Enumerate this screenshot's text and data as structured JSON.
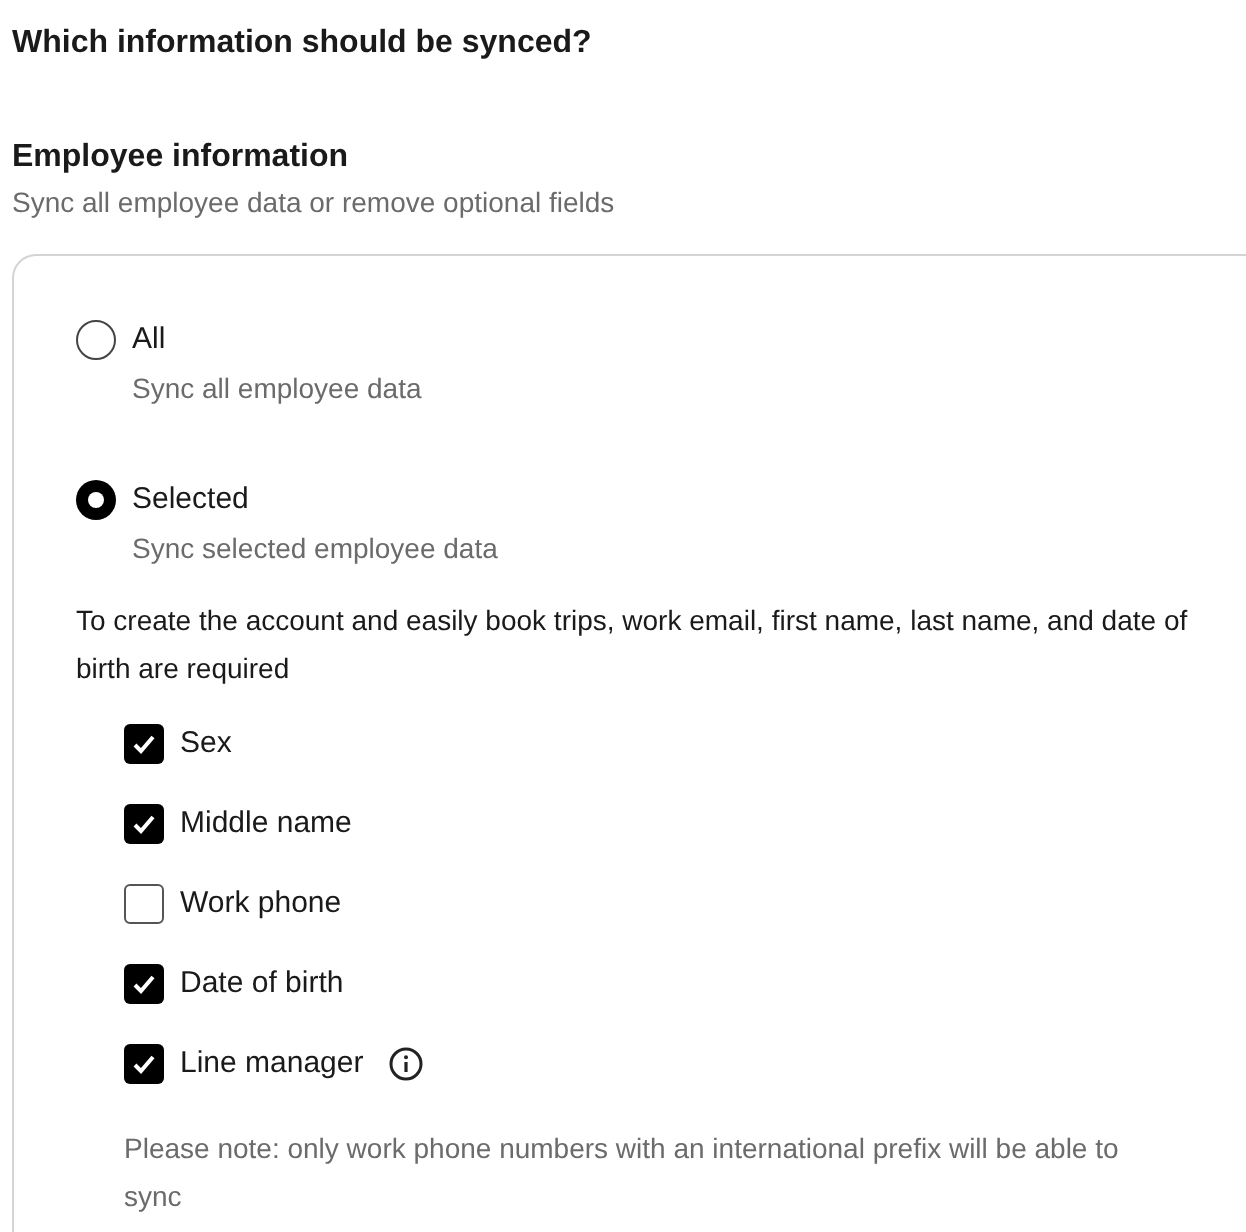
{
  "title": "Which information should be synced?",
  "section": {
    "heading": "Employee information",
    "description": "Sync all employee data or remove optional fields"
  },
  "options": [
    {
      "label": "All",
      "description": "Sync all employee data",
      "selected": false
    },
    {
      "label": "Selected",
      "description": "Sync selected employee data",
      "selected": true
    }
  ],
  "requirement": "To create the account and easily book trips, work email, first name, last name, and date of birth are required",
  "fields": [
    {
      "label": "Sex",
      "checked": true,
      "info": false
    },
    {
      "label": "Middle name",
      "checked": true,
      "info": false
    },
    {
      "label": "Work phone",
      "checked": false,
      "info": false
    },
    {
      "label": "Date of birth",
      "checked": true,
      "info": false
    },
    {
      "label": "Line manager",
      "checked": true,
      "info": true
    }
  ],
  "note": "Please note: only work phone numbers with an international prefix will be able to sync"
}
